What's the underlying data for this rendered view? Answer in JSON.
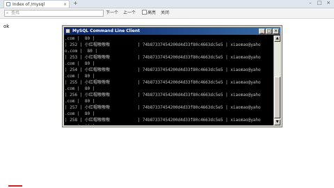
{
  "tab": {
    "title": "Index of /mysql",
    "close": "×"
  },
  "newtab": "+",
  "window": {
    "minimize": "–",
    "maximize": "□",
    "close": "×"
  },
  "findbar": {
    "close": "×",
    "placeholder": "查找",
    "next": "下一个",
    "prev": "上一个",
    "highlight": "高亮",
    "close_label": "关闭"
  },
  "page": {
    "text": "ok"
  },
  "console": {
    "title": "MySQL Command Line Client",
    "min": "_",
    "max": "□",
    "close": "×",
    "lines": [
      ".com |  80 |",
      "| 252 | 小红帽嗷嗷嗷           | 74b87337454200d4d33f80c4663dc5e5 | xiaomao@yaho",
      "o.com |  80 |",
      "| 253 | 小红帽嗷嗷嗷           | 74b87337454200d4d33f80c4663dc5e5 | xiaomao@yaho",
      ".com |  80 |",
      "| 254 | 小红帽嗷嗷嗷           | 74b87337454200d4d33f80c4663dc5e5 | xiaomao@yaho",
      ".com |  80 |",
      "| 255 | 小红帽嗷嗷嗷           | 74b87337454200d4d33f80c4663dc5e5 | xiaomao@yaho",
      ".com |  80 |",
      "| 256 | 小红帽嗷嗷嗷           | 74b87337454200d4d33f80c4663dc5e5 | xiaomao@yaho",
      ".com |  80 |",
      "| 257 | 小红帽嗷嗷嗷           | 74b87337454200d4d33f80c4663dc5e5 | xiaomao@yaho",
      ".com |  80 |",
      "| 258 | 小红帽嗷嗷嗷           | 74b87337454200d4d33f80c4663dc5e5 | xiaomao@yaho",
      ".com |  80 |",
      "| 259 | 小红帽嗷嗷嗷           | 74b87337454200d4d33f80c4663dc5e5 | xiaomao@yaho",
      ".com |  80 |"
    ]
  },
  "colors": {
    "titlebar_start": "#0a246a",
    "titlebar_end": "#3a6ea5",
    "console_bg": "#000000",
    "console_text": "#c0c0c0"
  }
}
